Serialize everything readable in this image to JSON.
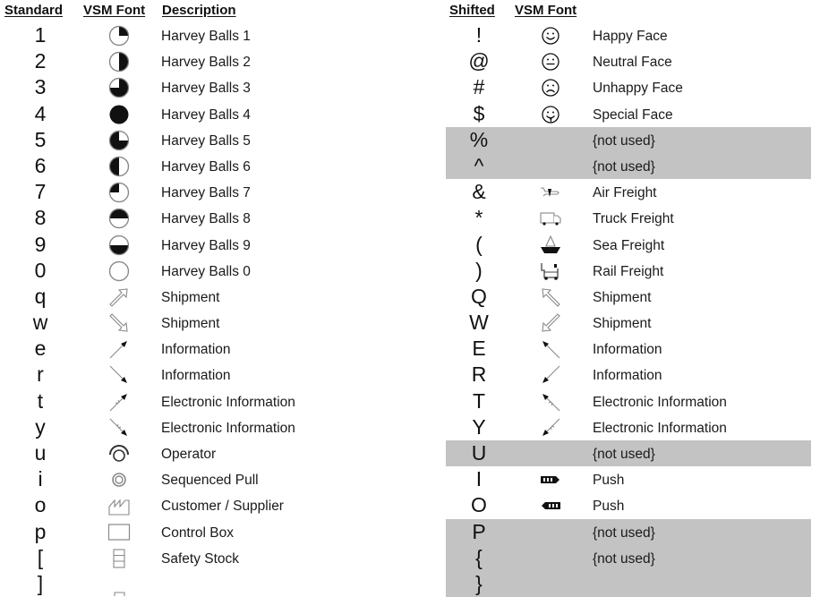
{
  "left_table": {
    "headers": {
      "key": "Standard",
      "font": "VSM Font",
      "description": "Description"
    },
    "rows": [
      {
        "key": "1",
        "icon": "harvey-ball-25-icon",
        "description": "Harvey Balls 1",
        "used": true
      },
      {
        "key": "2",
        "icon": "harvey-ball-50-icon",
        "description": "Harvey Balls 2",
        "used": true
      },
      {
        "key": "3",
        "icon": "harvey-ball-75-icon",
        "description": "Harvey Balls 3",
        "used": true
      },
      {
        "key": "4",
        "icon": "harvey-ball-100-icon",
        "description": "Harvey Balls 4",
        "used": true
      },
      {
        "key": "5",
        "icon": "harvey-ball-inverse-25-icon",
        "description": "Harvey Balls 5",
        "used": true
      },
      {
        "key": "6",
        "icon": "harvey-ball-left-half-icon",
        "description": "Harvey Balls 6",
        "used": true
      },
      {
        "key": "7",
        "icon": "harvey-ball-top-left-quarter-icon",
        "description": "Harvey Balls 7",
        "used": true
      },
      {
        "key": "8",
        "icon": "harvey-ball-top-half-icon",
        "description": "Harvey Balls 8",
        "used": true
      },
      {
        "key": "9",
        "icon": "harvey-ball-bottom-half-icon",
        "description": "Harvey Balls 9",
        "used": true
      },
      {
        "key": "0",
        "icon": "harvey-ball-empty-icon",
        "description": "Harvey Balls 0",
        "used": true
      },
      {
        "key": "q",
        "icon": "shipment-arrow-up-right-icon",
        "description": "Shipment",
        "used": true
      },
      {
        "key": "w",
        "icon": "shipment-arrow-down-right-icon",
        "description": "Shipment",
        "used": true
      },
      {
        "key": "e",
        "icon": "information-arrow-up-right-icon",
        "description": "Information",
        "used": true
      },
      {
        "key": "r",
        "icon": "information-arrow-down-right-icon",
        "description": "Information",
        "used": true
      },
      {
        "key": "t",
        "icon": "electronic-info-arrow-up-right-icon",
        "description": "Electronic Information",
        "used": true
      },
      {
        "key": "y",
        "icon": "electronic-info-arrow-down-right-icon",
        "description": "Electronic Information",
        "used": true
      },
      {
        "key": "u",
        "icon": "operator-icon",
        "description": "Operator",
        "used": true
      },
      {
        "key": "i",
        "icon": "sequenced-pull-icon",
        "description": "Sequenced Pull",
        "used": true
      },
      {
        "key": "o",
        "icon": "factory-icon",
        "description": "Customer / Supplier",
        "used": true
      },
      {
        "key": "p",
        "icon": "control-box-icon",
        "description": "Control Box",
        "used": true
      },
      {
        "key": "[",
        "icon": "safety-stock-icon",
        "description": "Safety Stock",
        "used": true
      },
      {
        "key": "]",
        "icon": "partial-icon",
        "description": "",
        "used": true
      }
    ]
  },
  "right_table": {
    "headers": {
      "key": "Shifted",
      "font": "VSM Font"
    },
    "rows": [
      {
        "key": "!",
        "icon": "happy-face-icon",
        "description": "Happy Face",
        "used": true
      },
      {
        "key": "@",
        "icon": "neutral-face-icon",
        "description": "Neutral Face",
        "used": true
      },
      {
        "key": "#",
        "icon": "unhappy-face-icon",
        "description": "Unhappy Face",
        "used": true
      },
      {
        "key": "$",
        "icon": "special-face-icon",
        "description": "Special Face",
        "used": true
      },
      {
        "key": "%",
        "icon": "",
        "description": "{not used}",
        "used": false
      },
      {
        "key": "^",
        "icon": "",
        "description": "{not used}",
        "used": false
      },
      {
        "key": "&",
        "icon": "air-freight-icon",
        "description": "Air Freight",
        "used": true
      },
      {
        "key": "*",
        "icon": "truck-freight-icon",
        "description": "Truck Freight",
        "used": true
      },
      {
        "key": "(",
        "icon": "sea-freight-icon",
        "description": "Sea Freight",
        "used": true
      },
      {
        "key": ")",
        "icon": "rail-freight-icon",
        "description": "Rail Freight",
        "used": true
      },
      {
        "key": "Q",
        "icon": "shipment-arrow-up-left-icon",
        "description": "Shipment",
        "used": true
      },
      {
        "key": "W",
        "icon": "shipment-arrow-down-left-icon",
        "description": "Shipment",
        "used": true
      },
      {
        "key": "E",
        "icon": "information-arrow-up-left-icon",
        "description": "Information",
        "used": true
      },
      {
        "key": "R",
        "icon": "information-arrow-down-left-icon",
        "description": "Information",
        "used": true
      },
      {
        "key": "T",
        "icon": "electronic-info-arrow-up-left-icon",
        "description": "Electronic Information",
        "used": true
      },
      {
        "key": "Y",
        "icon": "electronic-info-arrow-down-left-icon",
        "description": "Electronic Information",
        "used": true
      },
      {
        "key": "U",
        "icon": "",
        "description": "{not used}",
        "used": false
      },
      {
        "key": "I",
        "icon": "push-arrow-right-icon",
        "description": "Push",
        "used": true
      },
      {
        "key": "O",
        "icon": "push-arrow-left-icon",
        "description": "Push",
        "used": true
      },
      {
        "key": "P",
        "icon": "",
        "description": "{not used}",
        "used": false
      },
      {
        "key": "{",
        "icon": "",
        "description": "{not used}",
        "used": false
      },
      {
        "key": "}",
        "icon": "",
        "description": "",
        "used": false
      }
    ]
  },
  "colors": {
    "unused_row_bg": "#c3c3c3",
    "text": "#111111"
  }
}
